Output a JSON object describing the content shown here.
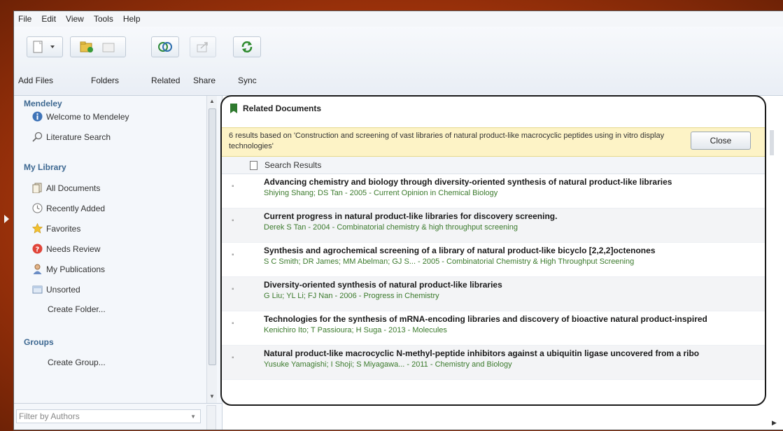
{
  "menu": [
    "File",
    "Edit",
    "View",
    "Tools",
    "Help"
  ],
  "toolbar": {
    "add_files": "Add Files",
    "folders": "Folders",
    "related": "Related",
    "share": "Share",
    "sync": "Sync"
  },
  "sidebar": {
    "mendeley_heading": "Mendeley",
    "welcome": "Welcome to Mendeley",
    "literature_search": "Literature Search",
    "my_library_heading": "My Library",
    "all_documents": "All Documents",
    "recently_added": "Recently Added",
    "favorites": "Favorites",
    "needs_review": "Needs Review",
    "my_publications": "My Publications",
    "unsorted": "Unsorted",
    "create_folder": "Create Folder...",
    "groups_heading": "Groups",
    "create_group": "Create Group...",
    "filter_placeholder": "Filter by Authors"
  },
  "panel": {
    "title": "Related Documents",
    "banner": "6 results based on 'Construction and screening of vast libraries of natural product-like macrocyclic peptides using in vitro display technologies'",
    "close_label": "Close",
    "results_header": "Search Results",
    "results": [
      {
        "title": "Advancing chemistry and biology through diversity-oriented synthesis of natural product-like libraries",
        "meta": "Shiying Shang; DS Tan - 2005 - Current Opinion in Chemical Biology"
      },
      {
        "title": "Current progress in natural product-like libraries for discovery screening.",
        "meta": "Derek S Tan - 2004 - Combinatorial chemistry & high throughput screening"
      },
      {
        "title": "Synthesis and agrochemical screening of a library of natural product-like bicyclo [2,2,2]octenones",
        "meta": "S C Smith; DR James; MM Abelman; GJ S... - 2005 - Combinatorial Chemistry & High Throughput Screening"
      },
      {
        "title": "Diversity-oriented synthesis of natural product-like libraries",
        "meta": "G Liu; YL Li; FJ Nan - 2006 - Progress in Chemistry"
      },
      {
        "title": "Technologies for the synthesis of mRNA-encoding libraries and discovery of bioactive natural product-inspired",
        "meta": "Kenichiro Ito; T Passioura; H Suga - 2013 - Molecules"
      },
      {
        "title": "Natural product-like macrocyclic N-methyl-peptide inhibitors against a ubiquitin ligase uncovered from a ribo",
        "meta": "Yusuke Yamagishi; I Shoji; S Miyagawa... - 2011 - Chemistry and Biology"
      }
    ]
  },
  "colors": {
    "frame": "#a4340b",
    "heading_blue": "#3d6891",
    "meta_green": "#3b7a2c",
    "banner_yellow": "#fdf3c6"
  }
}
